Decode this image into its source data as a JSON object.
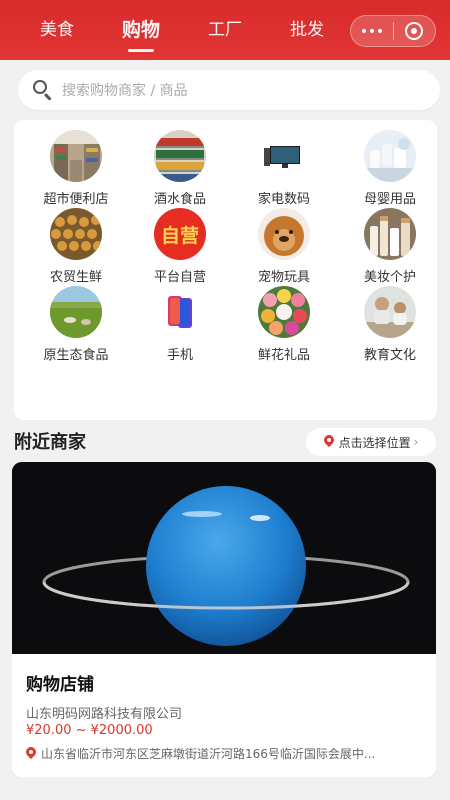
{
  "header": {
    "tabs": [
      {
        "label": "美食",
        "active": false
      },
      {
        "label": "购物",
        "active": true
      },
      {
        "label": "工厂",
        "active": false
      },
      {
        "label": "批发",
        "active": false
      }
    ],
    "bg_color": "#dd2e2e"
  },
  "search": {
    "placeholder": "搜索购物商家 / 商品"
  },
  "categories": [
    {
      "label": "超市便利店",
      "icon": "supermarket-image"
    },
    {
      "label": "酒水食品",
      "icon": "beverage-shelf-image"
    },
    {
      "label": "家电数码",
      "icon": "tv-image"
    },
    {
      "label": "母婴用品",
      "icon": "baby-products-image"
    },
    {
      "label": "农贸生鲜",
      "icon": "fresh-produce-image"
    },
    {
      "label": "平台自营",
      "icon": "self-operated-badge",
      "badge_text": "自营"
    },
    {
      "label": "宠物玩具",
      "icon": "dog-image"
    },
    {
      "label": "美妆个护",
      "icon": "cosmetics-image"
    },
    {
      "label": "原生态食品",
      "icon": "pasture-image"
    },
    {
      "label": "手机",
      "icon": "phone-image"
    },
    {
      "label": "鲜花礼品",
      "icon": "flowers-image"
    },
    {
      "label": "教育文化",
      "icon": "education-image"
    }
  ],
  "nearby": {
    "title": "附近商家",
    "locate_label": "点击选择位置"
  },
  "shop": {
    "name": "购物店铺",
    "company": "山东明码网路科技有限公司",
    "price": "¥20.00 ~ ¥2000.00",
    "address": "山东省临沂市河东区芝麻墩街道沂河路166号临沂国际会展中..."
  },
  "colors": {
    "accent": "#dd2e2e",
    "price": "#d9362b"
  }
}
